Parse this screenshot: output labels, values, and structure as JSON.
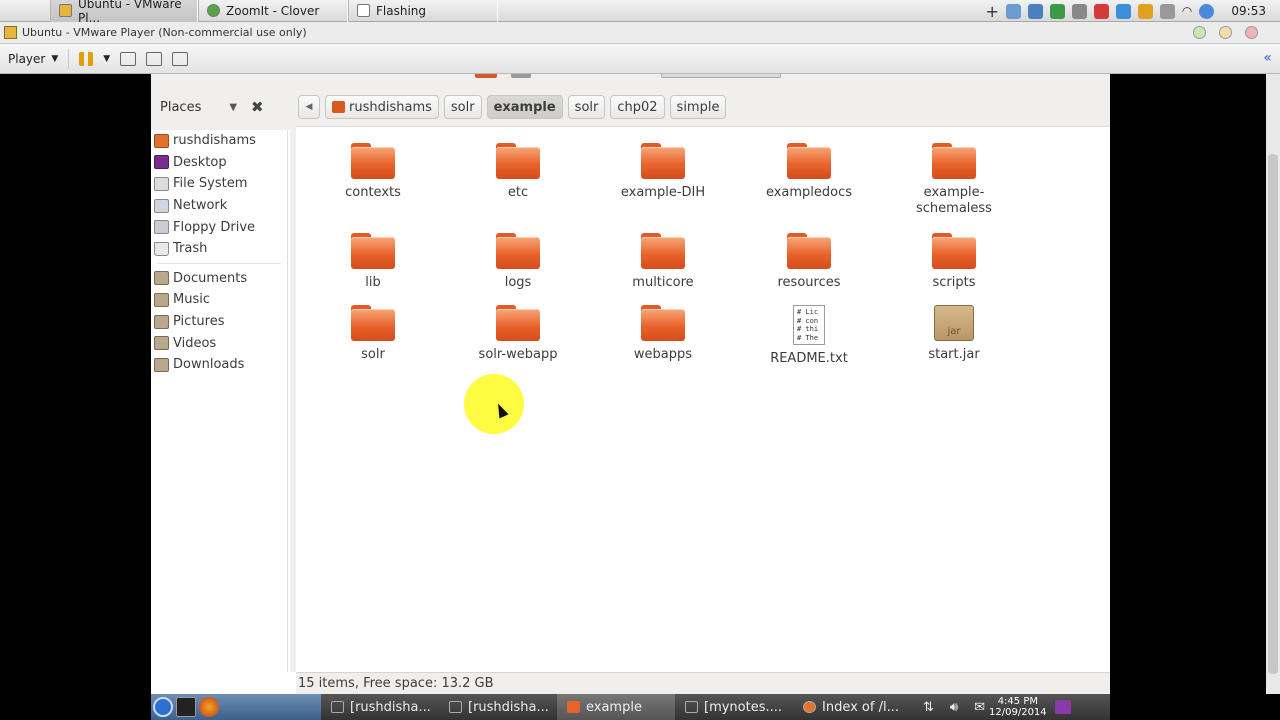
{
  "mac_bar": {
    "tabs": [
      {
        "label": "Ubuntu - VMware Pl..."
      },
      {
        "label": "ZoomIt - Clover"
      },
      {
        "label": "Flashing"
      }
    ],
    "clock": "09:53"
  },
  "vmware": {
    "title": "Ubuntu - VMware Player (Non-commercial use only)",
    "player_label": "Player"
  },
  "nautilus": {
    "places_label": "Places",
    "breadcrumbs": [
      "rushdishams",
      "solr",
      "example",
      "solr",
      "chp02",
      "simple"
    ],
    "active_crumb_index": 2,
    "sidebar": {
      "devices": [
        {
          "label": "rushdishams",
          "icon": "home-folder-icon"
        },
        {
          "label": "Desktop",
          "icon": "desktop-icon"
        },
        {
          "label": "File System",
          "icon": "filesystem-icon"
        },
        {
          "label": "Network",
          "icon": "network-icon"
        },
        {
          "label": "Floppy Drive",
          "icon": "floppy-icon"
        },
        {
          "label": "Trash",
          "icon": "trash-icon"
        }
      ],
      "bookmarks": [
        {
          "label": "Documents",
          "icon": "folder-icon"
        },
        {
          "label": "Music",
          "icon": "folder-icon"
        },
        {
          "label": "Pictures",
          "icon": "folder-icon"
        },
        {
          "label": "Videos",
          "icon": "folder-icon"
        },
        {
          "label": "Downloads",
          "icon": "folder-icon"
        }
      ]
    },
    "files": [
      {
        "name": "contexts",
        "type": "folder"
      },
      {
        "name": "etc",
        "type": "folder"
      },
      {
        "name": "example-DIH",
        "type": "folder"
      },
      {
        "name": "exampledocs",
        "type": "folder"
      },
      {
        "name": "example-schemaless",
        "type": "folder"
      },
      {
        "name": "lib",
        "type": "folder"
      },
      {
        "name": "logs",
        "type": "folder"
      },
      {
        "name": "multicore",
        "type": "folder"
      },
      {
        "name": "resources",
        "type": "folder"
      },
      {
        "name": "scripts",
        "type": "folder"
      },
      {
        "name": "solr",
        "type": "folder"
      },
      {
        "name": "solr-webapp",
        "type": "folder"
      },
      {
        "name": "webapps",
        "type": "folder"
      },
      {
        "name": "README.txt",
        "type": "text",
        "preview": "# Lic\n# con\n# thi\n# The"
      },
      {
        "name": "start.jar",
        "type": "jar",
        "badge": "jar"
      }
    ],
    "status": "15 items, Free space: 13.2 GB"
  },
  "taskbar": {
    "tasks": [
      {
        "label": "[rushdisha...",
        "icon": "terminal-icon"
      },
      {
        "label": "[rushdisha...",
        "icon": "terminal-icon"
      },
      {
        "label": "example",
        "icon": "folder-icon"
      },
      {
        "label": "[mynotes....",
        "icon": "text-editor-icon"
      },
      {
        "label": "Index of /l...",
        "icon": "firefox-icon"
      }
    ],
    "active_task_index": 2,
    "time": "4:45 PM",
    "date": "12/09/2014"
  },
  "colors": {
    "folder_orange": "#e8622b",
    "cursor_highlight": "#fffa1e"
  }
}
